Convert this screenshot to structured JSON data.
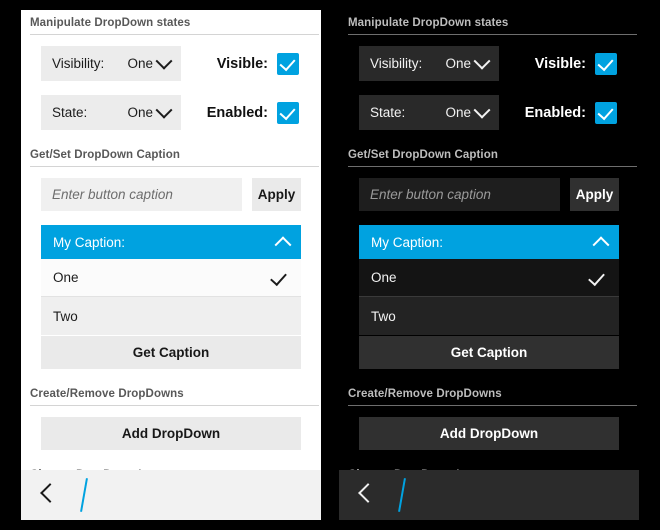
{
  "accent_color": "#00a2e0",
  "panels": [
    {
      "theme": "light",
      "name": "light-theme-panel"
    },
    {
      "theme": "dark",
      "name": "dark-theme-panel"
    }
  ],
  "sections": {
    "states": {
      "title": "Manipulate DropDown states",
      "rows": [
        {
          "combo_label": "Visibility:",
          "combo_value": "One",
          "check_label": "Visible:",
          "checked": true
        },
        {
          "combo_label": "State:",
          "combo_value": "One",
          "check_label": "Enabled:",
          "checked": true
        }
      ]
    },
    "caption": {
      "title": "Get/Set DropDown Caption",
      "input_placeholder": "Enter button caption",
      "input_value": "",
      "apply_label": "Apply",
      "dropdown": {
        "header_label": "My Caption:",
        "expanded": true,
        "items": [
          {
            "label": "One",
            "selected": true
          },
          {
            "label": "Two",
            "selected": false
          }
        ]
      },
      "get_caption_label": "Get Caption"
    },
    "create": {
      "title": "Create/Remove DropDowns",
      "add_label": "Add DropDown"
    },
    "change": {
      "title": "Change DropDown Items"
    }
  },
  "bottom_bar": {
    "back_icon": "chevron-left-icon",
    "caret_icon": "text-caret"
  },
  "icons": {
    "chevron_down": "chevron-down-icon",
    "chevron_up": "chevron-up-icon",
    "check": "check-icon",
    "back": "chevron-left-icon"
  }
}
